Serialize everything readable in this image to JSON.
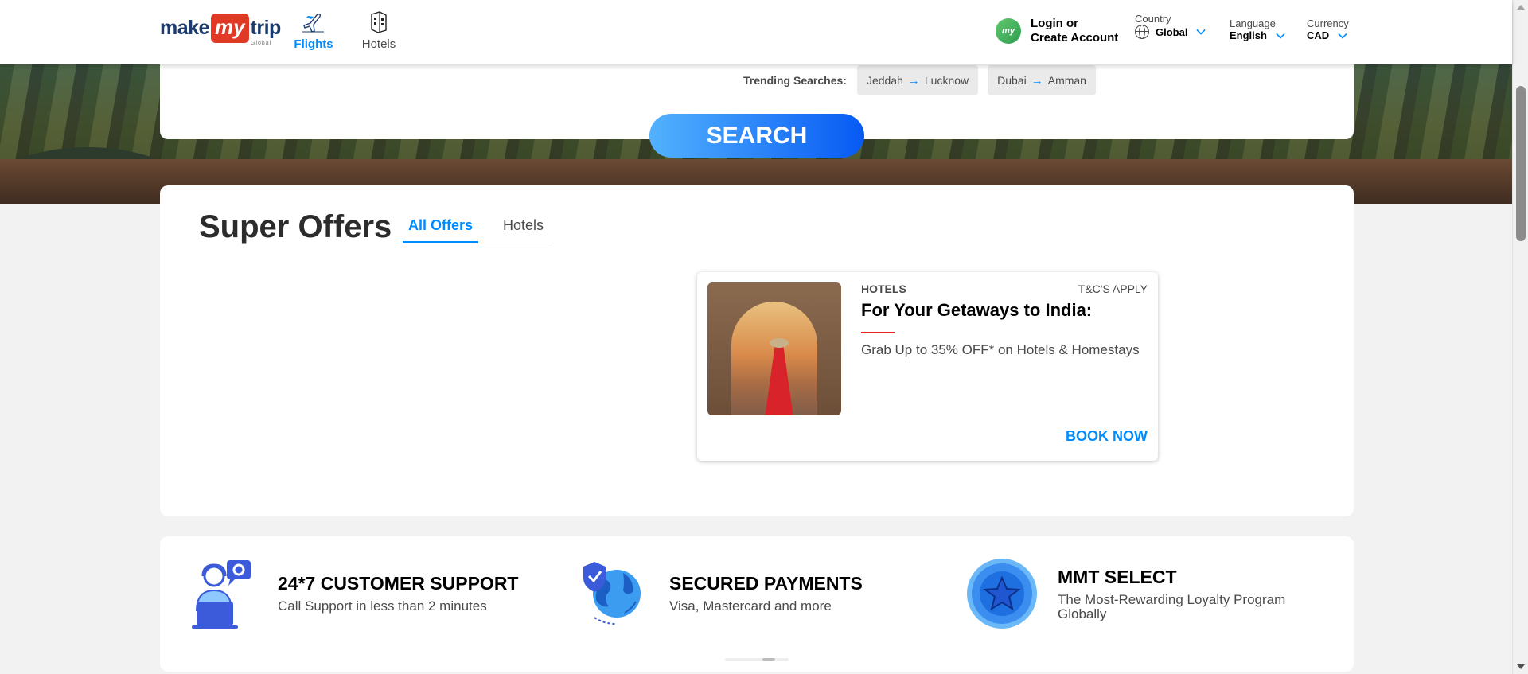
{
  "header": {
    "logo": {
      "make": "make",
      "my": "my",
      "trip": "trip",
      "global": "Global"
    },
    "nav": [
      {
        "label": "Flights",
        "icon": "airplane-icon",
        "active": true
      },
      {
        "label": "Hotels",
        "icon": "hotel-building-icon",
        "active": false
      }
    ],
    "login": {
      "avatar": "my",
      "line1": "Login or",
      "line2": "Create Account"
    },
    "country": {
      "caption": "Country",
      "value": "Global"
    },
    "language": {
      "caption": "Language",
      "value": "English"
    },
    "currency": {
      "caption": "Currency",
      "value": "CAD"
    },
    "accent_color": "#008cff"
  },
  "search": {
    "trending_label": "Trending Searches:",
    "trending": [
      {
        "from": "Jeddah",
        "to": "Lucknow"
      },
      {
        "from": "Dubai",
        "to": "Amman"
      }
    ],
    "button_label": "SEARCH"
  },
  "offers": {
    "title": "Super Offers",
    "tabs": [
      {
        "label": "All Offers",
        "active": true
      },
      {
        "label": "Hotels",
        "active": false
      }
    ],
    "card": {
      "category": "HOTELS",
      "terms": "T&C'S APPLY",
      "title": "For Your Getaways to India:",
      "description": "Grab Up to 35% OFF* on Hotels & Homestays",
      "cta": "BOOK NOW"
    }
  },
  "features": [
    {
      "title": "24*7 CUSTOMER SUPPORT",
      "description": "Call Support in less than 2 minutes",
      "icon": "customer-support-icon"
    },
    {
      "title": "SECURED PAYMENTS",
      "description": "Visa, Mastercard and more",
      "icon": "secure-globe-icon"
    },
    {
      "title": "MMT SELECT",
      "description": "The Most-Rewarding Loyalty Program Globally",
      "icon": "star-badge-icon"
    }
  ]
}
